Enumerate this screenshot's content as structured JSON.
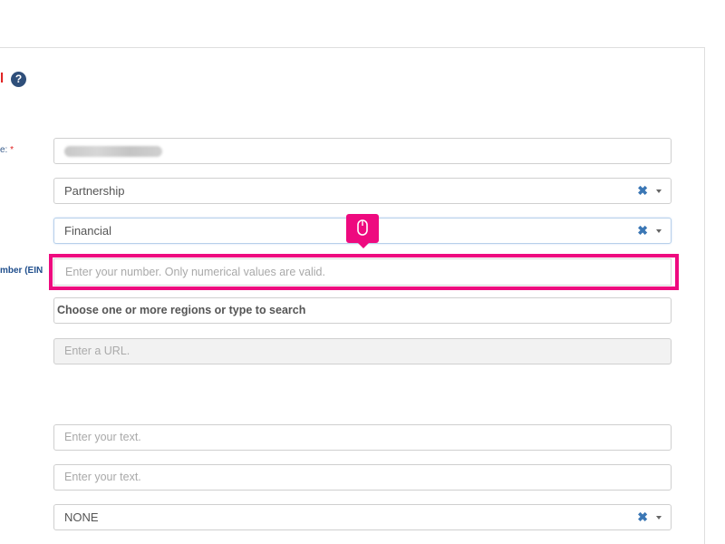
{
  "section": {
    "title_fragment": "l",
    "help_glyph": "?"
  },
  "labels": {
    "name_fragment": "e:",
    "name_required": "*",
    "ein_fragment": "mber (EIN"
  },
  "form": {
    "company_type": {
      "value": "Partnership",
      "clear": "✖"
    },
    "industry": {
      "value": "Financial",
      "clear": "✖"
    },
    "ein": {
      "placeholder": "Enter your number. Only numerical values are valid."
    },
    "regions": {
      "placeholder": "Choose one or more regions or type to search"
    },
    "url": {
      "placeholder": "Enter a URL."
    },
    "text1": {
      "placeholder": "Enter your text."
    },
    "text2": {
      "placeholder": "Enter your text."
    },
    "status": {
      "value": "NONE",
      "clear": "✖"
    }
  },
  "overlay": {
    "icon": "mouse-icon",
    "color": "#ee0a7f"
  }
}
